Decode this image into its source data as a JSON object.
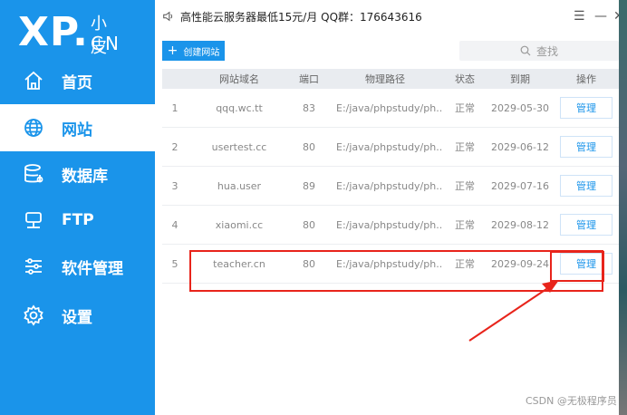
{
  "logo": {
    "xp": "XP.",
    "xiaopi": "小皮",
    "cn": "CN"
  },
  "sidebar": {
    "items": [
      {
        "label": "首页",
        "icon": "home-icon"
      },
      {
        "label": "网站",
        "icon": "globe-icon",
        "active": true
      },
      {
        "label": "数据库",
        "icon": "database-icon"
      },
      {
        "label": "FTP",
        "icon": "ftp-icon"
      },
      {
        "label": "软件管理",
        "icon": "sliders-icon"
      },
      {
        "label": "设置",
        "icon": "gear-icon"
      }
    ]
  },
  "topbar": {
    "notice": "高性能云服务器最低15元/月  QQ群：176643616",
    "menu": "☰",
    "minimize": "—",
    "close": "✕"
  },
  "toolbar": {
    "create_label": "创建网站",
    "search_placeholder": "查找"
  },
  "table": {
    "headers": [
      "网站域名",
      "端口",
      "物理路径",
      "状态",
      "到期",
      "操作"
    ],
    "rows": [
      {
        "id": "1",
        "domain": "qqq.wc.tt",
        "port": "83",
        "path": "E:/java/phpstudy/ph...",
        "status": "正常",
        "expire": "2029-05-30",
        "action": "管理"
      },
      {
        "id": "2",
        "domain": "usertest.cc",
        "port": "80",
        "path": "E:/java/phpstudy/ph...",
        "status": "正常",
        "expire": "2029-06-12",
        "action": "管理"
      },
      {
        "id": "3",
        "domain": "hua.user",
        "port": "89",
        "path": "E:/java/phpstudy/ph...",
        "status": "正常",
        "expire": "2029-07-16",
        "action": "管理"
      },
      {
        "id": "4",
        "domain": "xiaomi.cc",
        "port": "80",
        "path": "E:/java/phpstudy/ph...",
        "status": "正常",
        "expire": "2029-08-12",
        "action": "管理"
      },
      {
        "id": "5",
        "domain": "teacher.cn",
        "port": "80",
        "path": "E:/java/phpstudy/ph...",
        "status": "正常",
        "expire": "2029-09-24",
        "action": "管理"
      }
    ]
  },
  "watermark": "CSDN @无极程序员",
  "colors": {
    "accent": "#1a94ea",
    "annotation": "#e8241b"
  }
}
